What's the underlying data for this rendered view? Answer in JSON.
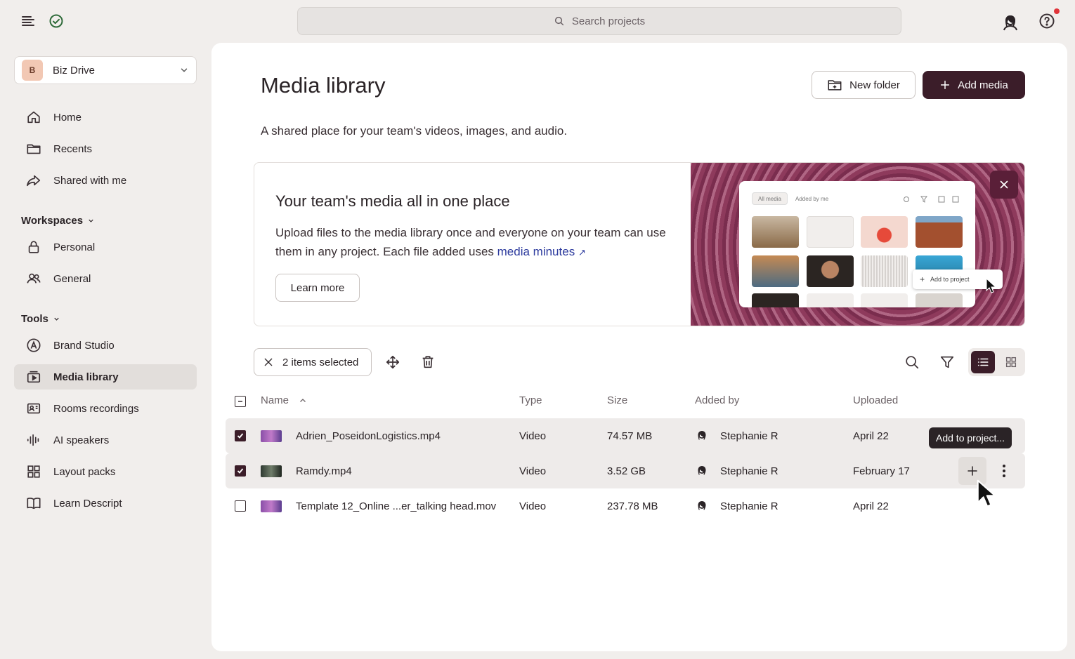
{
  "search": {
    "placeholder": "Search projects"
  },
  "sidebar": {
    "drive": {
      "badge": "B",
      "name": "Biz Drive"
    },
    "nav": [
      {
        "label": "Home",
        "icon": "home-icon"
      },
      {
        "label": "Recents",
        "icon": "folder-icon"
      },
      {
        "label": "Shared with me",
        "icon": "share-icon"
      }
    ],
    "workspaces_label": "Workspaces",
    "workspaces": [
      {
        "label": "Personal",
        "icon": "lock-icon"
      },
      {
        "label": "General",
        "icon": "people-icon"
      }
    ],
    "tools_label": "Tools",
    "tools": [
      {
        "label": "Brand Studio",
        "icon": "brand-icon"
      },
      {
        "label": "Media library",
        "icon": "media-library-icon",
        "active": true
      },
      {
        "label": "Rooms recordings",
        "icon": "rooms-icon"
      },
      {
        "label": "AI speakers",
        "icon": "waveform-icon"
      },
      {
        "label": "Layout packs",
        "icon": "grid-icon"
      },
      {
        "label": "Learn Descript",
        "icon": "book-icon"
      }
    ]
  },
  "main": {
    "title": "Media library",
    "subtitle": "A shared place for your team's videos, images, and audio.",
    "new_folder_label": "New folder",
    "add_media_label": "Add media"
  },
  "banner": {
    "title": "Your team's media all in one place",
    "text": "Upload files to the media library once and everyone on your team can use them in any project. Each file added uses ",
    "link": "media minutes",
    "learn_more": "Learn more",
    "mock_tabs": [
      "All media",
      "Added by me"
    ],
    "mock_popup": "Add to project"
  },
  "toolbar": {
    "selected_label": "2 items selected"
  },
  "table": {
    "headers": {
      "name": "Name",
      "type": "Type",
      "size": "Size",
      "added_by": "Added by",
      "uploaded": "Uploaded"
    },
    "rows": [
      {
        "name": "Adrien_PoseidonLogistics.mp4",
        "type": "Video",
        "size": "74.57 MB",
        "added_by": "Stephanie R",
        "uploaded": "April 22",
        "checked": true
      },
      {
        "name": "Ramdy.mp4",
        "type": "Video",
        "size": "3.52 GB",
        "added_by": "Stephanie R",
        "uploaded": "February 17",
        "checked": true
      },
      {
        "name": "Template 12_Online ...er_talking head.mov",
        "type": "Video",
        "size": "237.78 MB",
        "added_by": "Stephanie R",
        "uploaded": "April 22",
        "checked": false
      }
    ],
    "tooltip": "Add to project..."
  },
  "colors": {
    "accent": "#3b1d29",
    "link": "#2d3b9e",
    "notification": "#e0343a"
  }
}
